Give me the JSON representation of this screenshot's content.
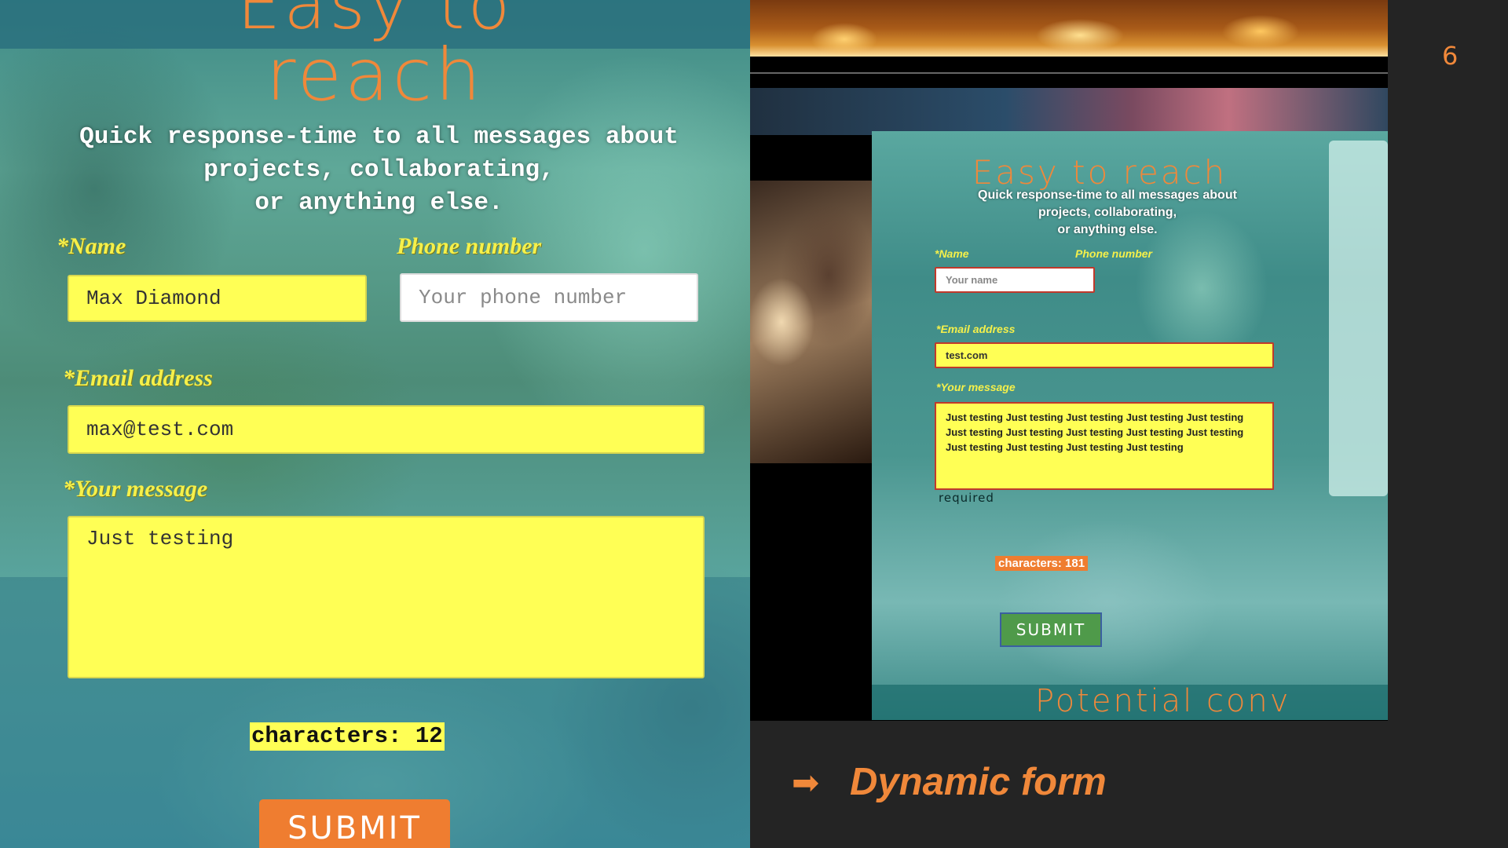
{
  "slide": {
    "page_number": "6",
    "arrow_icon": "arrow-right-icon",
    "caption": "Dynamic form",
    "accent_color": "#f0883a",
    "background_color": "#242424"
  },
  "left": {
    "heading_line1": "Easy to",
    "heading_line2": "reach",
    "intro_line1": "Quick response-time to all messages about",
    "intro_line2": "projects, collaborating,",
    "intro_line3": "or anything else.",
    "name_label": "*Name",
    "name_value": "Max Diamond",
    "phone_label": "Phone number",
    "phone_placeholder": "Your phone number",
    "email_label": "*Email address",
    "email_value": "max@test.com",
    "message_label": "*Your message",
    "message_value": "Just testing",
    "counter": "characters: 12",
    "submit_label": "SUBMIT"
  },
  "right": {
    "heading": "Easy to reach",
    "intro_line1": "Quick response-time to all messages about",
    "intro_line2": "projects, collaborating,",
    "intro_line3": "or anything else.",
    "name_label": "*Name",
    "name_placeholder": "Your name",
    "phone_label": "Phone number",
    "email_label": "*Email address",
    "email_value": "test.com",
    "message_label": "*Your message",
    "message_value": "Just testing Just testing Just testing Just testing Just testing Just testing Just testing Just testing Just testing Just testing Just testing Just testing Just testing Just testing",
    "required_note": "required",
    "counter": "characters: 181",
    "submit_label": "SUBMIT",
    "bottom_text": "Potential conv"
  }
}
